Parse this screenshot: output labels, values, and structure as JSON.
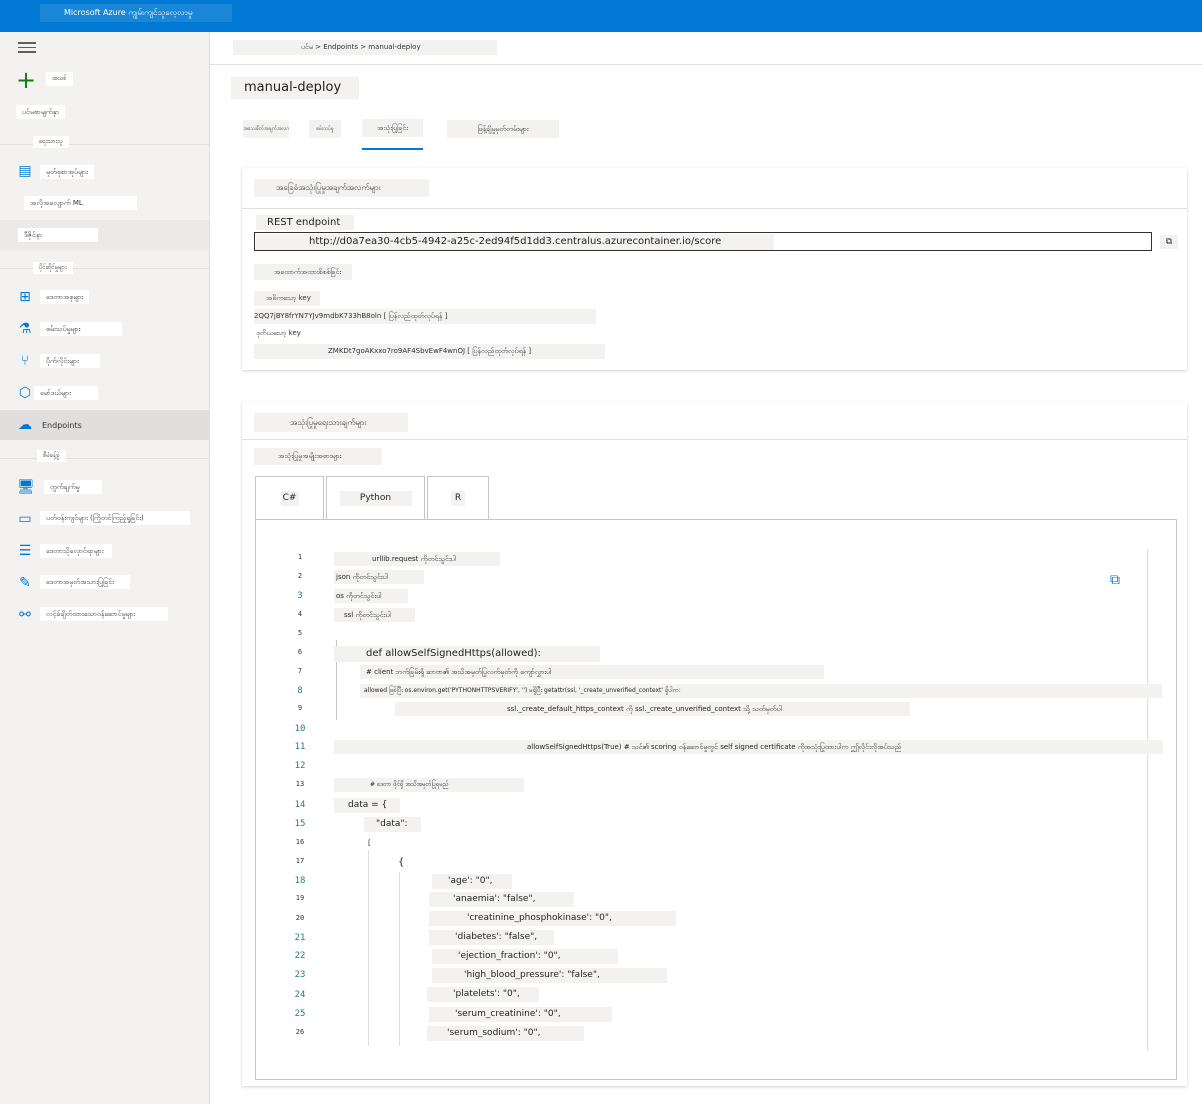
{
  "app": {
    "title": "Microsoft Azure ကျွမ်းကျင်သူလေ့လာမှု"
  },
  "sidebar": {
    "new_label": "အသစ်",
    "home_label": "ပင်မစာမျက်နှာ",
    "section_author": "ရေးသားသူ",
    "items_author": [
      {
        "label": "မှတ်စုစာအုပ်များ",
        "icon": "notebook-icon"
      },
      {
        "label": "အလိုအလျောက် ML",
        "icon": "automl-icon"
      },
      {
        "label": "ဒီဇိုင်နာ",
        "icon": "designer-icon"
      }
    ],
    "section_assets": "ပိုင်ဆိုင်မှုများ",
    "items_assets": [
      {
        "label": "ဒေတာအစုများ",
        "icon": "datasets-icon"
      },
      {
        "label": "စမ်းသပ်မှုများ",
        "icon": "experiments-icon"
      },
      {
        "label": "ပိုက်လိုင်းများ",
        "icon": "pipelines-icon"
      },
      {
        "label": "မော်ဒယ်များ",
        "icon": "models-icon"
      },
      {
        "label": "Endpoints",
        "icon": "endpoints-icon"
      }
    ],
    "section_manage": "စီမံခန့်ခွဲ",
    "items_manage": [
      {
        "label": "တွက်ချက်မှု",
        "icon": "compute-icon"
      },
      {
        "label": "ပတ်ဝန်းကျင်များ (ကြိုတင်ကြည့်ရှုခြင်း)",
        "icon": "environments-icon"
      },
      {
        "label": "ဒေတာသိုလှောင်ရာများ",
        "icon": "datastores-icon"
      },
      {
        "label": "ဒေတာအမှတ်အသားပြုခြင်း",
        "icon": "labeling-icon"
      },
      {
        "label": "လင့်ခ်ချိတ်ထားသောဝန်ဆောင်မှုများ",
        "icon": "linked-services-icon"
      }
    ]
  },
  "breadcrumb": "ပင်မ > Endpoints > manual-deploy",
  "page": {
    "title": "manual-deploy",
    "tabs": [
      "အသေးစိတ်အချက်အလက်",
      "စမ်းသပ်မှု",
      "အသုံးပြုခြင်း",
      "ဖြန့်ချိမှုမှတ်တမ်းများ"
    ]
  },
  "consume": {
    "basics_title": "အခြေခံအသုံးပြုမှုအချက်အလက်များ",
    "rest_label": "REST endpoint",
    "rest_url": "http://d0a7ea30-4cb5-4942-a25c-2ed94f5d1dd3.centralus.azurecontainer.io/score",
    "copy_label": "⧉",
    "auth_title": "အထောက်အထားစိစစ်ခြင်း",
    "primary_key_label": "အဓိကသော့ key",
    "primary_key_value": "2QQ7jBY8frYN7YJv9mdbK733hB8oln [ ပြန်လည်ထုတ်လုပ်ရန် ]",
    "secondary_key_label": "ဒုတိယသော့ key",
    "secondary_key_value": "ZMKDt7goAKxxo7ro9AF4SbvEwF4wnOJ [ ပြန်လည်ထုတ်လုပ်ရန် ]"
  },
  "script": {
    "title": "အသုံးပြုမှုရေးသားချက်များ",
    "subtitle": "အသုံးပြုမှုအမျိုးအစားများ",
    "langs": [
      "C#",
      "Python",
      "R"
    ],
    "lines": [
      "urllib.request ကိုတင်သွင်းပါ",
      "json ကိုတင်သွင်းပါ",
      "os ကိုတင်သွင်းပါ",
      "ssl ကိုတင်သွင်းပါ",
      "",
      "def allowSelfSignedHttps(allowed):",
      "# client ဘက်ခြမ်းရှိ ဆာဗာ၏ အသိအမှတ်ပြုလက်မှတ်ကို ကျော်လွှားပါ",
      "allowed ဖြစ်ပြီး os.environ.get('PYTHONHTTPSVERIFY', '') မရှိပြီး getattr(ssl, '_create_unverified_context' ရှိပါက:",
      "ssl._create_default_https_context ကို ssl._create_unverified_context သို့ သတ်မှတ်ပါ",
      "",
      "allowSelfSignedHttps(True) # သင်၏ scoring ဝန်ဆောင်မှုတွင် self signed certificate ကိုအသုံးပြုထားပါက ဤလိုင်းလိုအပ်သည်",
      "",
      "# ဒေတာ ဖိုင်ရှိ အသိအမှတ်ပြုရမည်",
      "data = {",
      "\"data\":",
      "[",
      "{",
      "'age': \"0\",",
      "'anaemia': \"false\",",
      "'creatinine_phosphokinase': \"0\",",
      "'diabetes': \"false\",",
      "'ejection_fraction': \"0\",",
      "'high_blood_pressure': \"false\",",
      "'platelets': \"0\",",
      "'serum_creatinine': \"0\",",
      "'serum_sodium': \"0\","
    ],
    "line_numbers": [
      "1",
      "2",
      "3",
      "4",
      "5",
      "6",
      "7",
      "8",
      "9",
      "10",
      "11",
      "12",
      "13",
      "14",
      "15",
      "16",
      "17",
      "18",
      "19",
      "20",
      "21",
      "22",
      "23",
      "24",
      "25",
      "26"
    ],
    "copy_icon": "copy-icon"
  },
  "colors": {
    "accent": "#0078d4",
    "topbar": "#0078d4",
    "sidebar_bg": "#f3f2f1"
  }
}
